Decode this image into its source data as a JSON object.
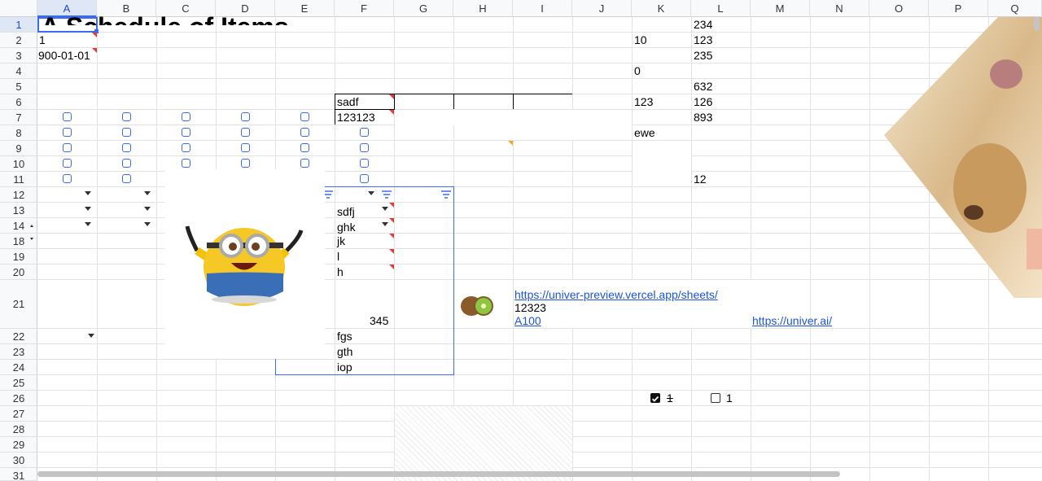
{
  "columns": [
    "A",
    "B",
    "C",
    "D",
    "E",
    "F",
    "G",
    "H",
    "I",
    "J",
    "K",
    "L",
    "M",
    "N",
    "O",
    "P",
    "Q"
  ],
  "rows": [
    "1",
    "2",
    "3",
    "4",
    "5",
    "6",
    "7",
    "8",
    "9",
    "10",
    "11",
    "12",
    "13",
    "14",
    "18",
    "19",
    "20",
    "21",
    "22",
    "23",
    "24",
    "25",
    "26",
    "27",
    "28",
    "29",
    "30",
    "31"
  ],
  "cells": {
    "a1_title": "A Schedule of Items",
    "a2": "1",
    "a3": "900-01-01",
    "k2": "10",
    "k4": "0",
    "k6": "123",
    "k8": "ewe",
    "l1": "234",
    "l2": "123",
    "l3": "235",
    "l5": "632",
    "l6": "126",
    "l7": "893",
    "l11": "12",
    "f6": "sadf",
    "f7": "123123",
    "f13": "sdfj",
    "f14": "ghk",
    "f18": "jk",
    "f19": "l",
    "f20": "h",
    "f21": "345",
    "f22": "fgs",
    "f23": "gth",
    "f24": "iop",
    "i21_link": "https://univer-preview.vercel.app/sheets/",
    "i21_value": "12323",
    "i21_ref": "A100",
    "m21_link": "https://univer.ai/",
    "k26_label": "1",
    "l26_label": "1"
  },
  "images": {
    "minion": "minion-cartoon-image",
    "kiwi": "kiwi-fruit-image",
    "dog": "pug-dog-photo"
  },
  "colors": {
    "accent": "#3b6cf0",
    "link": "#1a55d6",
    "comment_marker": "#e53935",
    "warning_marker": "#f4a722"
  }
}
